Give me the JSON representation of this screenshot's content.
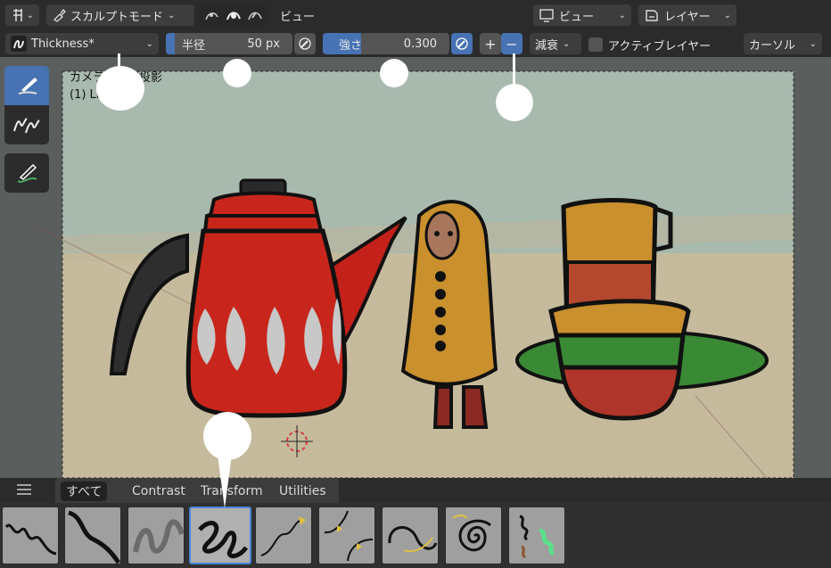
{
  "top_bar": {
    "mode_label": "スカルプトモード",
    "view_menu": "ビュー",
    "view_dropdown": "ビュー",
    "layer_dropdown": "レイヤー"
  },
  "tool_settings": {
    "brush_name": "Thickness*",
    "radius_label": "半径",
    "radius_value": "50 px",
    "strength_label": "強さ",
    "strength_value": "0.300",
    "falloff_label": "減衰",
    "active_layer_label": "アクティブレイヤー",
    "cursor_label": "カーソル",
    "plus_symbol": "+",
    "minus_symbol": "−"
  },
  "viewport": {
    "overlay_line1": "カメラ・透視投影",
    "overlay_line2": "(1) Li..."
  },
  "brush_tabs": [
    "すべて",
    "Contrast",
    "Transform",
    "Utilities"
  ],
  "colors": {
    "accent": "#4772b3",
    "header": "#2b2b2b",
    "teapot_red": "#c8261c",
    "coat_yellow": "#c9902d",
    "plate_green": "#3a8a35"
  },
  "icons": [
    "editor-type-icon",
    "brush-icon",
    "pen-pressure-icon",
    "monitor-icon",
    "layer-icon",
    "draw-tool-icon",
    "tweak-tool-icon",
    "stroke-tool-icon",
    "hamburger-icon"
  ]
}
